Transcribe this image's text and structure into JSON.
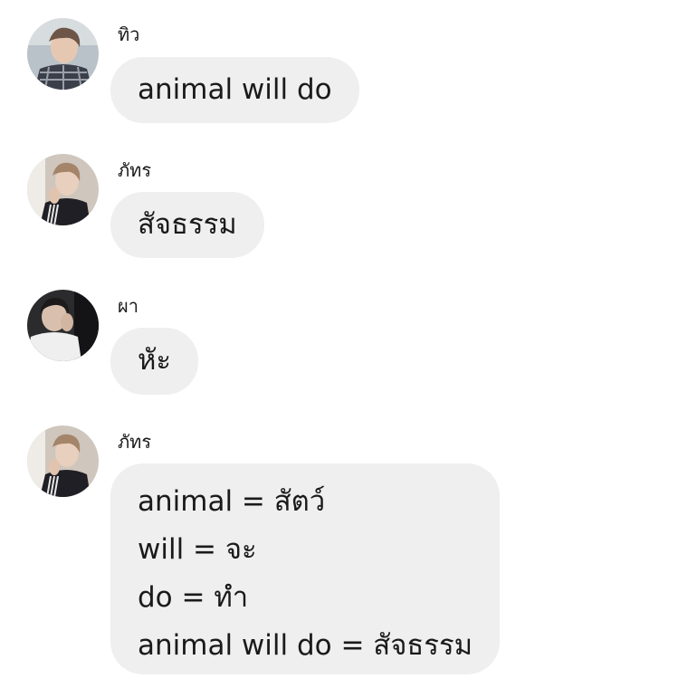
{
  "messages": [
    {
      "sender": "ทิว",
      "lines": [
        "animal will do"
      ]
    },
    {
      "sender": "ภัทร",
      "lines": [
        "สัจธรรม"
      ]
    },
    {
      "sender": "ผา",
      "lines": [
        "หัะ"
      ]
    },
    {
      "sender": "ภัทร",
      "lines": [
        "animal = สัตว์",
        "will = จะ",
        "do = ทำ",
        "animal will do = สัจธรรม"
      ]
    }
  ],
  "colors": {
    "bubble": "#efefef",
    "text": "#1a1a1a",
    "background": "#ffffff"
  }
}
